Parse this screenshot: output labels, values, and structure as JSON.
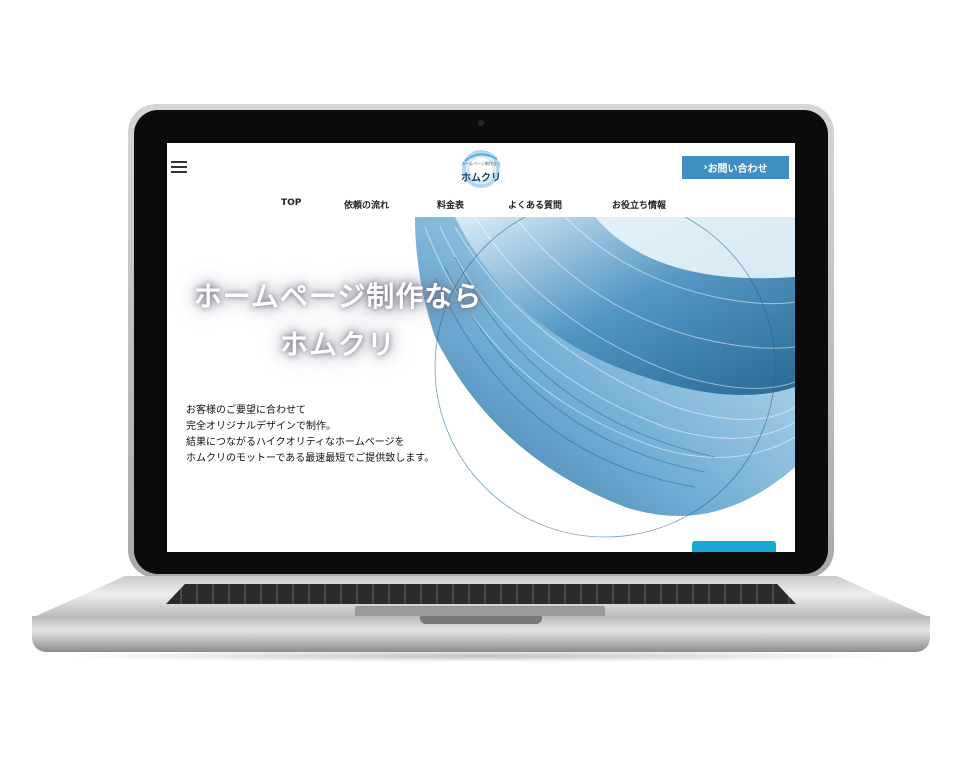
{
  "header": {
    "logo_subtitle": "ホームページ制作なら",
    "logo_title": "ホムクリ",
    "contact_label": "お問い合わせ"
  },
  "nav": [
    {
      "label": "TOP"
    },
    {
      "label": "依頼の流れ"
    },
    {
      "label": "料金表"
    },
    {
      "label": "よくある質問"
    },
    {
      "label": "お役立ち情報"
    }
  ],
  "hero": {
    "headline_line1": "ホームページ制作なら",
    "headline_line2": "ホムクリ",
    "copy": [
      "お客様のご要望に合わせて",
      "完全オリジナルデザインで制作。",
      "結果につながるハイクオリティなホームページを",
      "ホムクリのモットーである最速最短でご提供致します。"
    ]
  },
  "colors": {
    "accent": "#3f8fc0",
    "hero_button": "#1aa7d6",
    "wave_dark": "#1d5f8c",
    "wave_light": "#cde6f5"
  },
  "icons": {
    "menu": "hamburger-icon",
    "contact": "chevron-right-icon"
  }
}
